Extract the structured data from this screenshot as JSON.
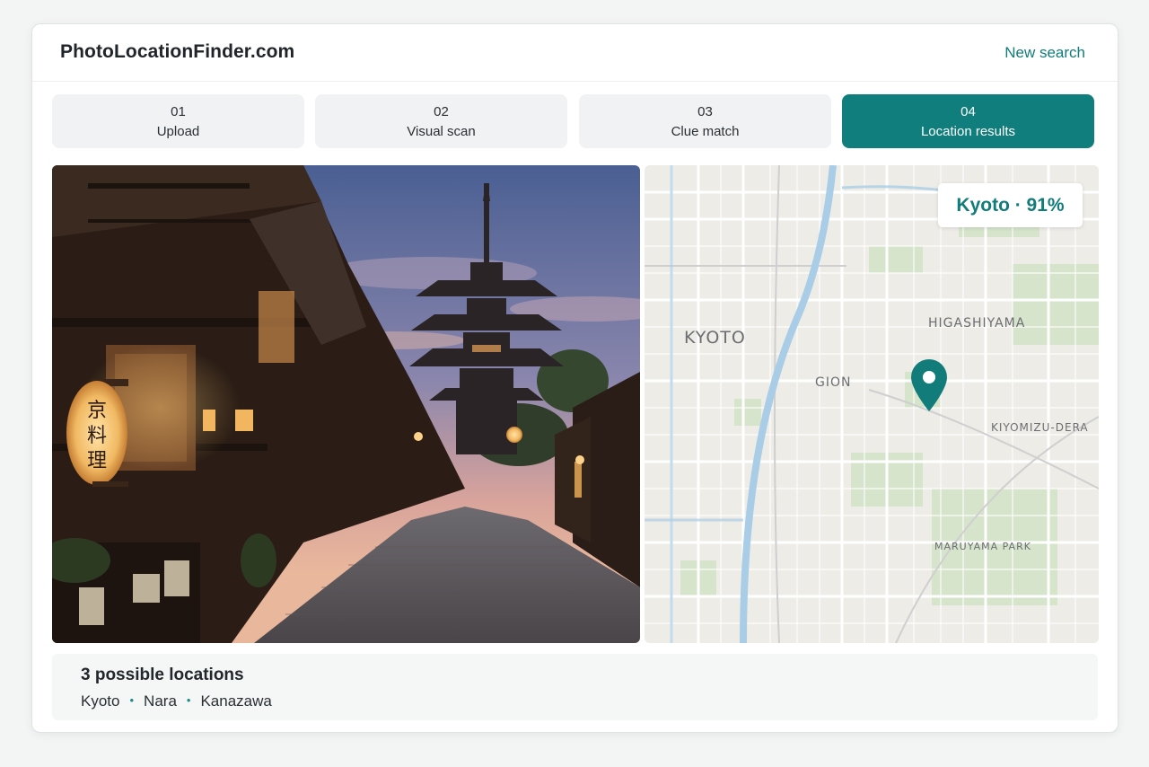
{
  "header": {
    "site_title": "PhotoLocationFinder.com",
    "new_search_label": "New search"
  },
  "steps": [
    {
      "number": "01",
      "label": "Upload",
      "active": false
    },
    {
      "number": "02",
      "label": "Visual scan",
      "active": false
    },
    {
      "number": "03",
      "label": "Clue match",
      "active": false
    },
    {
      "number": "04",
      "label": "Location results",
      "active": true
    }
  ],
  "photo": {
    "lantern_text": [
      "京",
      "料",
      "理"
    ]
  },
  "map": {
    "badge": "Kyoto · 91%",
    "labels": {
      "city": "KYOTO",
      "higashiyama": "HIGASHIYAMA",
      "gion": "GION",
      "kiyomizu": "KIYOMIZU-DERA",
      "maruyama": "MARUYAMA PARK"
    }
  },
  "results": {
    "title": "3 possible locations",
    "locations": [
      "Kyoto",
      "Nara",
      "Kanazawa"
    ],
    "separator": "•"
  },
  "colors": {
    "accent": "#107e7d",
    "accent_text": "#127c7b",
    "step_inactive": "#f1f2f3",
    "map_water": "#a9cde6",
    "map_park": "#d6e4cc"
  }
}
